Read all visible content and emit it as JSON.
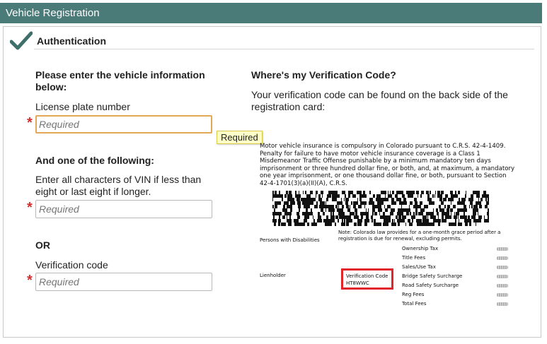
{
  "header": {
    "title": "Vehicle Registration"
  },
  "section": {
    "title": "Authentication"
  },
  "form": {
    "intro": "Please enter the vehicle information below:",
    "plate_label": "License plate number",
    "plate_placeholder": "Required",
    "tooltip": "Required",
    "one_of": "And one of the following:",
    "vin_label": "Enter all characters of VIN if less than eight or last eight if longer.",
    "vin_placeholder": "Required",
    "or_label": "OR",
    "code_label": "Verification code",
    "code_placeholder": "Required",
    "required_mark": "*"
  },
  "help": {
    "title": "Where's my Verification Code?",
    "text": "Your verification code can be found on the back side of the registration card:"
  },
  "card": {
    "notice": "Motor vehicle insurance is compulsory in Colorado pursuant to C.R.S. 42-4-1409. Penalty for failure to have motor vehicle insurance coverage is a Class 1 Misdemeanor Traffic Offense punishable by a minimum mandatory ten days imprisonment or three hundred dollar fine, or both, and, at maximum, a mandatory one year imprisonment, or one thousand dollar fine, or both, pursuant to Section 42-4-1701(3)(a)(II)(A), C.R.S.",
    "persons": "Persons with Disabilities",
    "note": "Note: Colorado law provides for a one-month grace period after a registration is due for renewal, excluding permits.",
    "lienholder": "Lienholder",
    "verification_label": "Verification Code",
    "verification_value": "HT8WWC",
    "fees": [
      "Ownership Tax",
      "Title Fees",
      "Sales/Use Tax",
      "Bridge Safety Surcharge",
      "Road Safety Surcharge",
      "Reg Fees",
      "Total Fees"
    ]
  },
  "colors": {
    "header_bg": "#4a7b78",
    "check": "#3f6f6b",
    "required": "#d32f2f",
    "focus_border": "#e0a857",
    "highlight": "#e0262b"
  }
}
